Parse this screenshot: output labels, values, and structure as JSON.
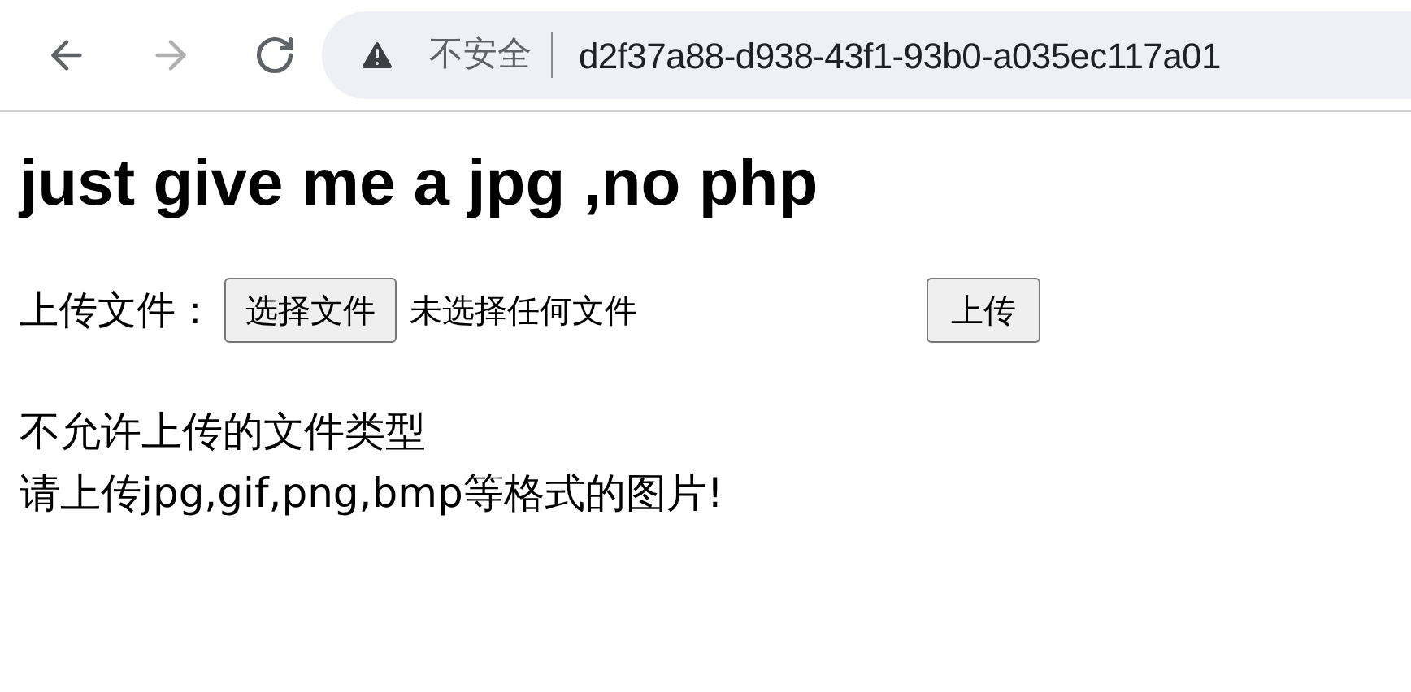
{
  "browser": {
    "back": {
      "disabled": false
    },
    "forward": {
      "disabled": true
    },
    "security_label": "不安全",
    "url": "d2f37a88-d938-43f1-93b0-a035ec117a01"
  },
  "page": {
    "heading": "just give me a jpg ,no php",
    "form": {
      "label": "上传文件：",
      "file_button": "选择文件",
      "file_status": "未选择任何文件",
      "submit": "上传"
    },
    "messages": [
      "不允许上传的文件类型",
      "请上传jpg,gif,png,bmp等格式的图片!"
    ]
  }
}
